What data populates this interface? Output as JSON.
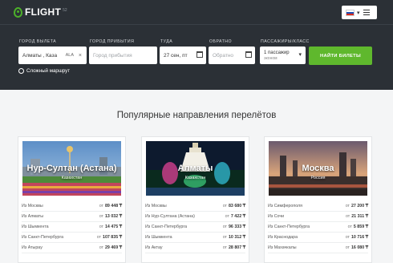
{
  "brand": {
    "name": "FLIGHT",
    "suffix": "52"
  },
  "language": {
    "current": "ru"
  },
  "search": {
    "from": {
      "label": "ГОРОД ВЫЛЕТА",
      "value": "Алматы , Каза",
      "code": "ALA",
      "clear": "×"
    },
    "to": {
      "label": "ГОРОД ПРИБЫТИЯ",
      "placeholder": "Город прибытия"
    },
    "depart": {
      "label": "ТУДА",
      "value": "27 сен, пт"
    },
    "return": {
      "label": "ОБРАТНО",
      "placeholder": "Обратно"
    },
    "passengers": {
      "label": "ПАССАЖИРЫ/КЛАСС",
      "value": "1 пассажир",
      "class": "эконом"
    },
    "submit": "НАЙТИ БИЛЕТЫ",
    "complex_route": "Сложный маршрут"
  },
  "section_title": "Популярные направления перелётов",
  "colors": {
    "header_bg": "#2b3036",
    "accent": "#5fb82d"
  },
  "destinations": [
    {
      "city": "Нур-Султан (Астана)",
      "country": "Казахстан",
      "routes": [
        {
          "from": "Из Москвы",
          "ot": "от",
          "price": "89 448 ₸"
        },
        {
          "from": "Из Алматы",
          "ot": "от",
          "price": "13 032 ₸"
        },
        {
          "from": "Из Шымкента",
          "ot": "от",
          "price": "14 475 ₸"
        },
        {
          "from": "Из Санкт-Петербурга",
          "ot": "от",
          "price": "107 835 ₸"
        },
        {
          "from": "Из Атырау",
          "ot": "от",
          "price": "29 469 ₸"
        }
      ]
    },
    {
      "city": "Алматы",
      "country": "Казахстан",
      "routes": [
        {
          "from": "Из Москвы",
          "ot": "от",
          "price": "83 680 ₸"
        },
        {
          "from": "Из Нур-Султана (Астана)",
          "ot": "от",
          "price": "7 422 ₸"
        },
        {
          "from": "Из Санкт-Петербурга",
          "ot": "от",
          "price": "96 333 ₸"
        },
        {
          "from": "Из Шымкента",
          "ot": "от",
          "price": "10 312 ₸"
        },
        {
          "from": "Из Актау",
          "ot": "от",
          "price": "28 807 ₸"
        }
      ]
    },
    {
      "city": "Москва",
      "country": "Россия",
      "routes": [
        {
          "from": "Из Симферополя",
          "ot": "от",
          "price": "27 200 ₸"
        },
        {
          "from": "Из Сочи",
          "ot": "от",
          "price": "21 311 ₸"
        },
        {
          "from": "Из Санкт-Петербурга",
          "ot": "от",
          "price": "5 859 ₸"
        },
        {
          "from": "Из Краснодара",
          "ot": "от",
          "price": "10 716 ₸"
        },
        {
          "from": "Из Махачкалы",
          "ot": "от",
          "price": "16 080 ₸"
        }
      ]
    }
  ]
}
